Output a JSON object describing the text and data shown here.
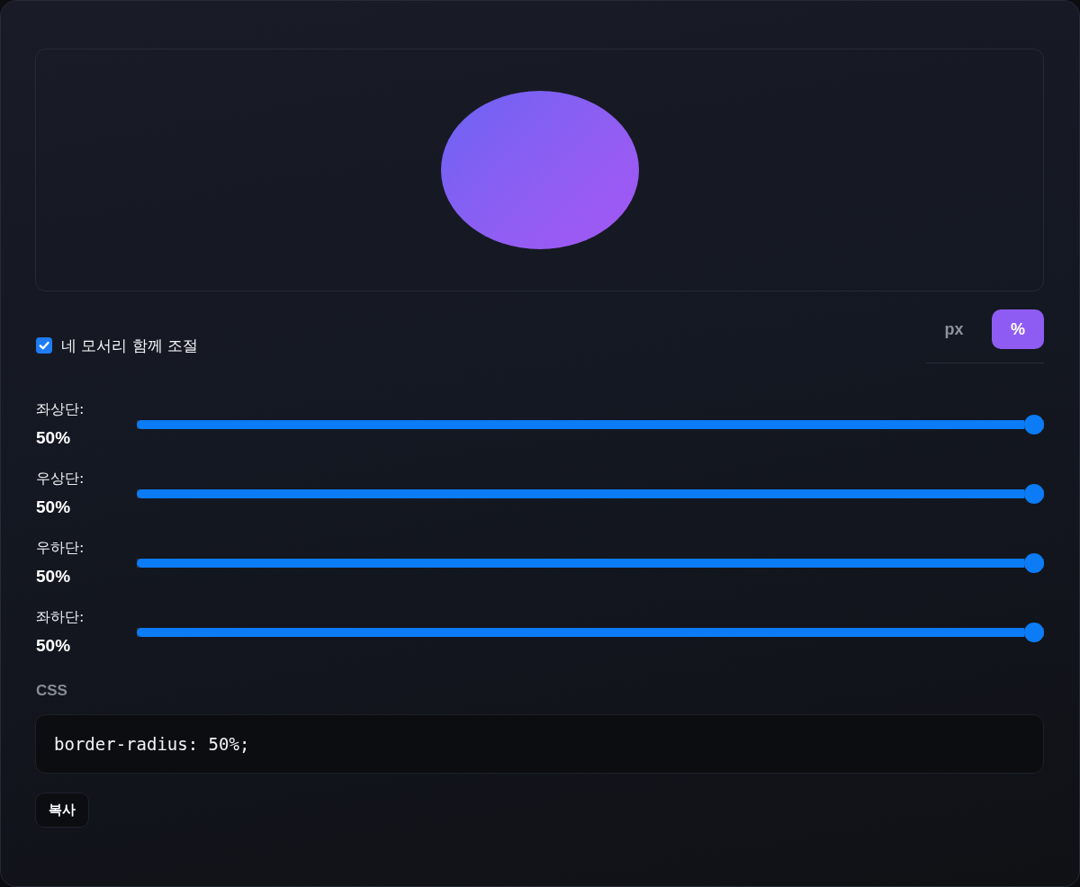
{
  "link_corners": {
    "label": "네 모서리 함께 조절",
    "checked": true
  },
  "units": [
    {
      "label": "px",
      "selected": false
    },
    {
      "label": "%",
      "selected": true
    }
  ],
  "corners": [
    {
      "label": "좌상단:",
      "value": "50%",
      "level": 1
    },
    {
      "label": "우상단:",
      "value": "50%",
      "level": 1
    },
    {
      "label": "우하단:",
      "value": "50%",
      "level": 1
    },
    {
      "label": "좌하단:",
      "value": "50%",
      "level": 1
    }
  ],
  "css": {
    "label": "CSS",
    "code": "border-radius: 50%;"
  },
  "copy_button": "복사"
}
